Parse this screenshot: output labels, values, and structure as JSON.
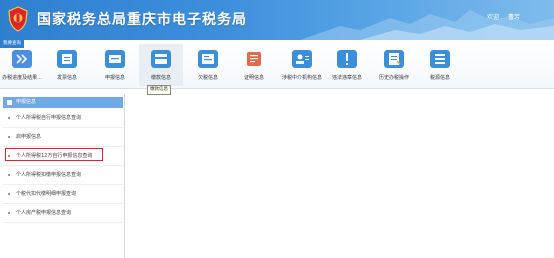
{
  "header": {
    "title": "国家税务总局重庆市电子税务局",
    "welcome": "欢迎",
    "username": "曹芳",
    "accent": "#2f7fd0"
  },
  "toolbar": {
    "section_tab": "我要查询",
    "tooltip": "缴款信息",
    "items": [
      {
        "label": "办税进度及结果...",
        "icon": "double-chevron-icon",
        "color": "#4a90e2"
      },
      {
        "label": "发票信息",
        "icon": "invoice-icon",
        "color": "#3b8fd9"
      },
      {
        "label": "申报信息",
        "icon": "declaration-icon",
        "color": "#3b8fd9"
      },
      {
        "label": "缴款信息",
        "icon": "payment-icon",
        "color": "#3b8fd9"
      },
      {
        "label": "欠税信息",
        "icon": "tax-owed-icon",
        "color": "#3b8fd9"
      },
      {
        "label": "证明信息",
        "icon": "certificate-icon",
        "color": "#e06a4b"
      },
      {
        "label": "涉税中介机构信息",
        "icon": "agency-icon",
        "color": "#3b8fd9"
      },
      {
        "label": "违法违章信息",
        "icon": "warning-icon",
        "color": "#3b8fd9"
      },
      {
        "label": "历史办税操作",
        "icon": "history-icon",
        "color": "#3b8fd9"
      },
      {
        "label": "税源信息",
        "icon": "tax-source-icon",
        "color": "#3b8fd9"
      }
    ]
  },
  "sidebar": {
    "heading": "申报信息",
    "items": [
      {
        "label": "个人所得税自行申报信息查询"
      },
      {
        "label": "启申报信息"
      },
      {
        "label": "个人所得税12万自行申报信息查询"
      },
      {
        "label": "个人所得税扣缴申报信息查询"
      },
      {
        "label": "个税代扣代缴明细申报查询"
      },
      {
        "label": "个人房产税申报信息查询"
      }
    ],
    "highlight_color": "#e2202a"
  }
}
